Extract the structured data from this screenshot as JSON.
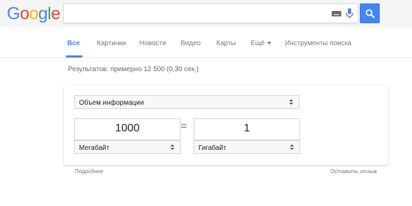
{
  "logo": {
    "letters": [
      "G",
      "o",
      "o",
      "g",
      "l",
      "e"
    ],
    "colors": [
      "#4285f4",
      "#ea4335",
      "#fbbc05",
      "#4285f4",
      "#34a853",
      "#ea4335"
    ]
  },
  "search": {
    "value": "",
    "placeholder": ""
  },
  "tabs": [
    {
      "label": "Все",
      "active": true
    },
    {
      "label": "Картинки"
    },
    {
      "label": "Новости"
    },
    {
      "label": "Видео"
    },
    {
      "label": "Карты"
    },
    {
      "label": "Ещё"
    },
    {
      "label": "Инструменты поиска"
    }
  ],
  "results_stats": "Результатов: примерно 12 500 (0,30 сек.)",
  "converter": {
    "category": "Объем информации",
    "from": {
      "value": "1000",
      "unit": "Мегабайт"
    },
    "equals": "=",
    "to": {
      "value": "1",
      "unit": "Гигабайт"
    }
  },
  "footer": {
    "more": "Подробнее",
    "feedback": "Оставить отзыв"
  },
  "colors": {
    "accent": "#4285f4",
    "header_bg": "#f5f5f5"
  }
}
